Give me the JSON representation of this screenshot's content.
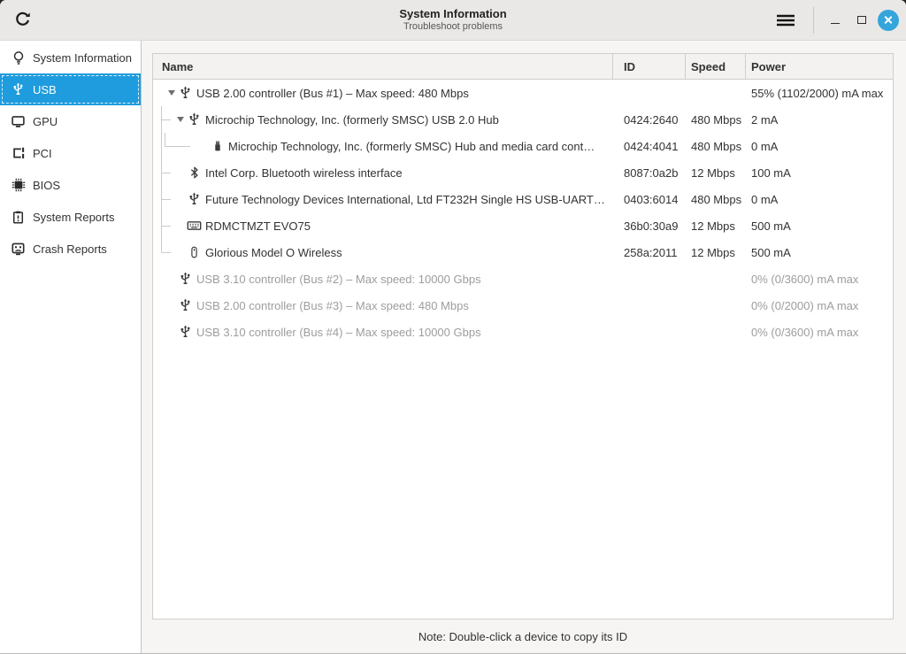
{
  "titlebar": {
    "title": "System Information",
    "subtitle": "Troubleshoot problems",
    "refresh_icon": "refresh-icon",
    "menu_icon": "hamburger-menu-icon",
    "window_buttons": [
      "minimize",
      "maximize",
      "close"
    ]
  },
  "sidebar": {
    "items": [
      {
        "label": "System Information",
        "icon": "lightbulb-icon",
        "selected": false
      },
      {
        "label": "USB",
        "icon": "usb-icon",
        "selected": true
      },
      {
        "label": "GPU",
        "icon": "gpu-monitor-icon",
        "selected": false
      },
      {
        "label": "PCI",
        "icon": "pci-card-icon",
        "selected": false
      },
      {
        "label": "BIOS",
        "icon": "chip-icon",
        "selected": false
      },
      {
        "label": "System Reports",
        "icon": "clipboard-report-icon",
        "selected": false
      },
      {
        "label": "Crash Reports",
        "icon": "crash-face-icon",
        "selected": false
      }
    ]
  },
  "table": {
    "columns": [
      {
        "key": "name",
        "label": "Name"
      },
      {
        "key": "id",
        "label": "ID"
      },
      {
        "key": "speed",
        "label": "Speed"
      },
      {
        "key": "power",
        "label": "Power"
      }
    ],
    "rows": [
      {
        "depth": 1,
        "expander": true,
        "icon": "usb-icon",
        "name": "USB 2.00 controller (Bus #1) – Max speed: 480 Mbps",
        "id": "",
        "speed": "",
        "power": "55% (1102/2000) mA max",
        "dimmed": false
      },
      {
        "depth": 2,
        "expander": true,
        "icon": "usb-icon",
        "name": "Microchip Technology, Inc. (formerly SMSC) USB 2.0 Hub",
        "id": "0424:2640",
        "speed": "480 Mbps",
        "power": "2 mA",
        "dimmed": false
      },
      {
        "depth": 3,
        "expander": false,
        "icon": "memory-stick-icon",
        "name": "Microchip Technology, Inc. (formerly SMSC) Hub and media card cont…",
        "id": "0424:4041",
        "speed": "480 Mbps",
        "power": "0 mA",
        "dimmed": false
      },
      {
        "depth": 2,
        "expander": false,
        "icon": "bluetooth-icon",
        "name": "Intel Corp. Bluetooth wireless interface",
        "id": "8087:0a2b",
        "speed": "12 Mbps",
        "power": "100 mA",
        "dimmed": false
      },
      {
        "depth": 2,
        "expander": false,
        "icon": "usb-icon",
        "name": "Future Technology Devices International, Ltd FT232H Single HS USB-UART…",
        "id": "0403:6014",
        "speed": "480 Mbps",
        "power": "0 mA",
        "dimmed": false
      },
      {
        "depth": 2,
        "expander": false,
        "icon": "keyboard-icon",
        "name": "RDMCTMZT EVO75",
        "id": "36b0:30a9",
        "speed": "12 Mbps",
        "power": "500 mA",
        "dimmed": false
      },
      {
        "depth": 2,
        "expander": false,
        "icon": "mouse-icon",
        "name": "Glorious Model O Wireless",
        "id": "258a:2011",
        "speed": "12 Mbps",
        "power": "500 mA",
        "dimmed": false
      },
      {
        "depth": 1,
        "expander": false,
        "icon": "usb-icon",
        "name": "USB 3.10 controller (Bus #2) – Max speed: 10000 Gbps",
        "id": "",
        "speed": "",
        "power": "0% (0/3600) mA max",
        "dimmed": true
      },
      {
        "depth": 1,
        "expander": false,
        "icon": "usb-icon",
        "name": "USB 2.00 controller (Bus #3) – Max speed: 480 Mbps",
        "id": "",
        "speed": "",
        "power": "0% (0/2000) mA max",
        "dimmed": true
      },
      {
        "depth": 1,
        "expander": false,
        "icon": "usb-icon",
        "name": "USB 3.10 controller (Bus #4) – Max speed: 10000 Gbps",
        "id": "",
        "speed": "",
        "power": "0% (0/3600) mA max",
        "dimmed": true
      }
    ]
  },
  "footer": {
    "note": "Note: Double-click a device to copy its ID"
  },
  "colors": {
    "accent": "#1f9cdd",
    "close_button": "#35a5dc",
    "titlebar_bg": "#e9e8e6",
    "content_bg": "#f6f5f4",
    "dimmed_text": "#9d9d9d"
  }
}
